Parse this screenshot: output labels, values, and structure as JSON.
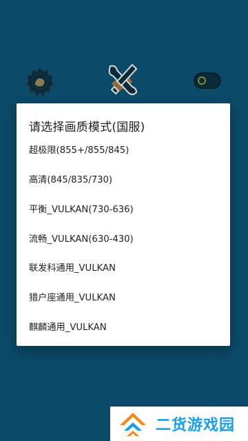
{
  "background": {
    "color": "#0b4a68"
  },
  "icons": {
    "gear": "gear-icon",
    "tools": "tools-icon",
    "toggle": "toggle-icon"
  },
  "dialog": {
    "title": "请选择画质模式(国服)",
    "options": [
      "超极限(855+/855/845)",
      "高清(845/835/730)",
      "平衡_VULKAN(730-636)",
      "流畅_VULKAN(630-430)",
      "联发科通用_VULKAN",
      "猎户座通用_VULKAN",
      "麒麟通用_VULKAN"
    ]
  },
  "watermark": {
    "logo": "site-logo",
    "text": "二货游戏园",
    "color": "#1a9fe6"
  }
}
